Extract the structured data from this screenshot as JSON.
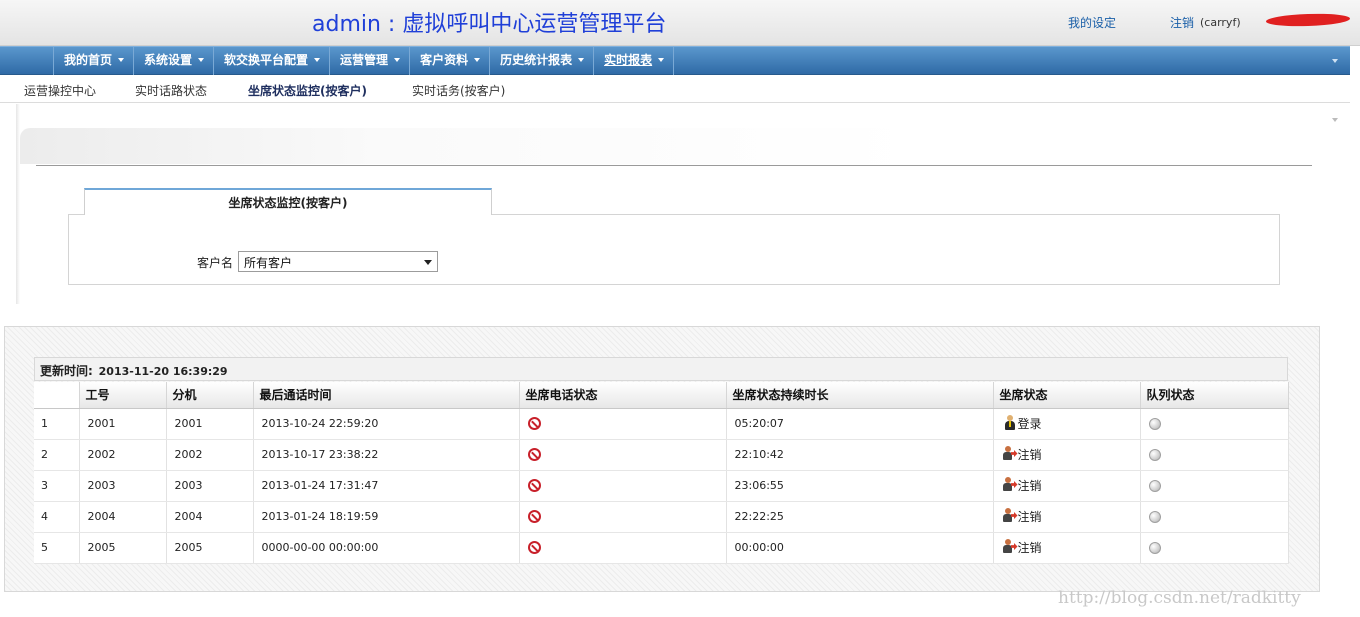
{
  "header": {
    "title": "admin : 虚拟呼叫中心运营管理平台",
    "my_settings": "我的设定",
    "logout": "注销",
    "user": "(carryf)"
  },
  "nav": {
    "items": [
      {
        "label": "我的首页"
      },
      {
        "label": "系统设置"
      },
      {
        "label": "软交换平台配置"
      },
      {
        "label": "运营管理"
      },
      {
        "label": "客户资料"
      },
      {
        "label": "历史统计报表"
      },
      {
        "label": "实时报表"
      }
    ],
    "active": "实时报表"
  },
  "subnav": {
    "items": [
      {
        "label": "运营操控中心"
      },
      {
        "label": "实时话路状态"
      },
      {
        "label": "坐席状态监控(按客户)"
      },
      {
        "label": "实时话务(按客户)"
      }
    ],
    "active": "坐席状态监控(按客户)"
  },
  "filter": {
    "tab_label": "坐席状态监控(按客户)",
    "customer_label": "客户名",
    "customer_value": "所有客户"
  },
  "table": {
    "updated_label": "更新时间:",
    "updated_value": "2013-11-20 16:39:29",
    "columns": [
      "",
      "工号",
      "分机",
      "最后通话时间",
      "坐席电话状态",
      "坐席状态持续时长",
      "坐席状态",
      "队列状态"
    ],
    "rows": [
      {
        "no": "1",
        "agent_id": "2001",
        "extension": "2001",
        "last_call": "2013-10-24 22:59:20",
        "phone_icon": "no-entry-icon",
        "duration": "05:20:07",
        "status_icon": "agent-icon",
        "status": "登录",
        "queue_icon": "gray-dot-icon"
      },
      {
        "no": "2",
        "agent_id": "2002",
        "extension": "2002",
        "last_call": "2013-10-17 23:38:22",
        "phone_icon": "no-entry-icon",
        "duration": "22:10:42",
        "status_icon": "logout-icon",
        "status": "注销",
        "queue_icon": "gray-dot-icon"
      },
      {
        "no": "3",
        "agent_id": "2003",
        "extension": "2003",
        "last_call": "2013-01-24 17:31:47",
        "phone_icon": "no-entry-icon",
        "duration": "23:06:55",
        "status_icon": "logout-icon",
        "status": "注销",
        "queue_icon": "gray-dot-icon"
      },
      {
        "no": "4",
        "agent_id": "2004",
        "extension": "2004",
        "last_call": "2013-01-24 18:19:59",
        "phone_icon": "no-entry-icon",
        "duration": "22:22:25",
        "status_icon": "logout-icon",
        "status": "注销",
        "queue_icon": "gray-dot-icon"
      },
      {
        "no": "5",
        "agent_id": "2005",
        "extension": "2005",
        "last_call": "0000-00-00 00:00:00",
        "phone_icon": "no-entry-icon",
        "duration": "00:00:00",
        "status_icon": "logout-icon",
        "status": "注销",
        "queue_icon": "gray-dot-icon"
      }
    ]
  },
  "watermark": "http://blog.csdn.net/radkitty",
  "colors": {
    "title": "#1f3fd8",
    "nav_bg": "#3f7ebd",
    "link": "#1a5fa8",
    "deny_red": "#c8202a"
  }
}
